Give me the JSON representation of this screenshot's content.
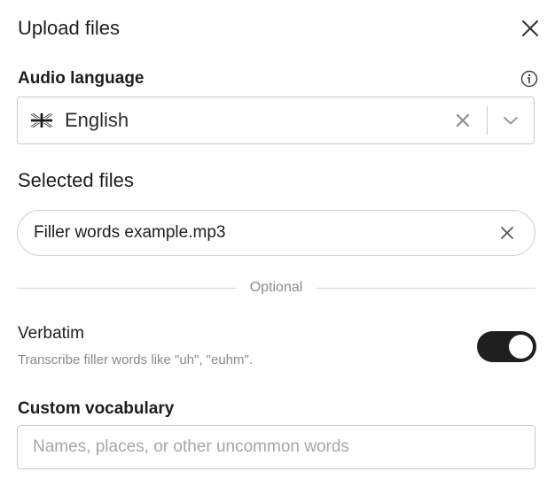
{
  "dialog": {
    "title": "Upload files"
  },
  "audio_language": {
    "label": "Audio language",
    "selected": "English",
    "flag": "uk-flag-icon"
  },
  "selected_files": {
    "title": "Selected files",
    "files": [
      {
        "name": "Filler words example.mp3"
      }
    ]
  },
  "divider": {
    "text": "Optional"
  },
  "verbatim": {
    "label": "Verbatim",
    "description": "Transcribe filler words like \"uh\", \"euhm\".",
    "enabled": true
  },
  "custom_vocabulary": {
    "label": "Custom vocabulary",
    "value": "",
    "placeholder": "Names, places, or other uncommon words"
  },
  "colors": {
    "toggle_on": "#1f1f1f",
    "border": "#c9c9c9",
    "muted_text": "#8a8a8a"
  }
}
